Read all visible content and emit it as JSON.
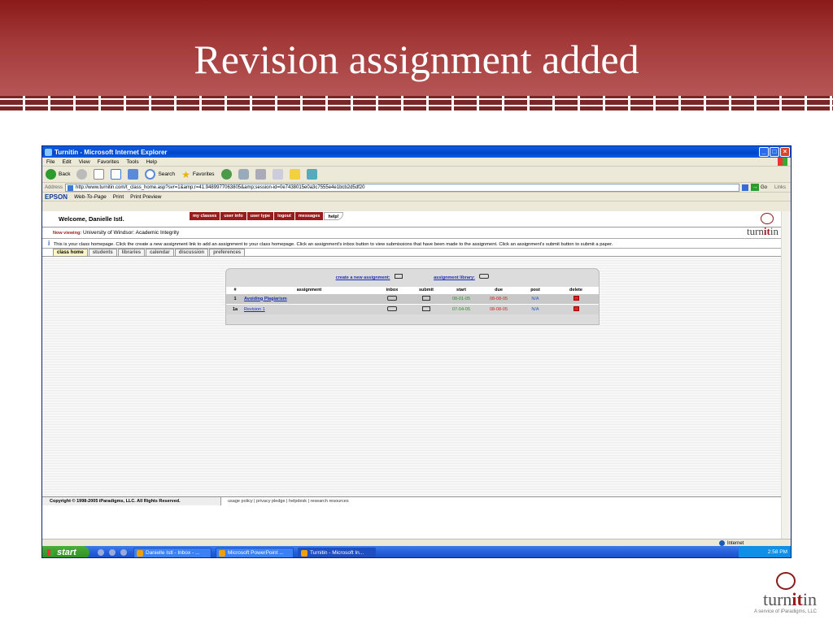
{
  "slide": {
    "title": "Revision assignment added"
  },
  "window": {
    "title": "Turnitin - Microsoft Internet Explorer",
    "menu": [
      "File",
      "Edit",
      "View",
      "Favorites",
      "Tools",
      "Help"
    ],
    "toolbar": {
      "back": "Back",
      "search": "Search",
      "favorites": "Favorites"
    },
    "address": {
      "label": "Address",
      "url": "http://www.turnitin.com/t_class_home.asp?svr=1&amp;r=41.9489977063805&amp;session-id=0e7438015e0a3c7555e4e1bcb2d5df20",
      "go": "Go",
      "links": "Links"
    },
    "epson": {
      "brand": "EPSON",
      "webtopage": "Web-To-Page",
      "print": "Print",
      "preview": "Print Preview"
    }
  },
  "turnitin": {
    "welcome": "Welcome, Danielle Istl.",
    "nav": [
      "my classes",
      "user info",
      "user type",
      "logout",
      "messages",
      "help!"
    ],
    "logo_pre": "turn",
    "logo_mid": "it",
    "logo_post": "in",
    "viewing_label": "Now viewing:",
    "viewing_value": "University of Windsor: Academic Integrity",
    "info": "This is your class homepage. Click the create a new assignment link to add an assignment to your class homepage. Click an assignment's inbox button to view submissions that have been made to the assignment. Click an assignment's submit button to submit a paper.",
    "tabs": [
      "class home",
      "students",
      "libraries",
      "calendar",
      "discussion",
      "preferences"
    ],
    "create_link": "create a new assignment:",
    "library_link": "assignment library:",
    "columns": [
      "#",
      "assignment",
      "inbox",
      "submit",
      "start",
      "due",
      "post",
      "delete"
    ],
    "rows": [
      {
        "num": "1",
        "name": "Avoiding Plagiarism",
        "start": "08-01-05",
        "due": "08-08-05",
        "post": "N/A"
      },
      {
        "num": "1a",
        "name": "Revision 1",
        "start": "07-04-05",
        "due": "08-08-05",
        "post": "N/A"
      }
    ],
    "copyright": "Copyright © 1998-2005 iParadigms, LLC. All Rights Reserved.",
    "footer_links": "usage policy | privacy pledge | helpdesk | research resources"
  },
  "status": {
    "zone": "Internet"
  },
  "taskbar": {
    "start": "start",
    "items": [
      "Danielle Istl - Inbox - ...",
      "Microsoft PowerPoint ...",
      "Turnitin - Microsoft In..."
    ],
    "clock": "2:58 PM"
  },
  "brand": {
    "pre": "turn",
    "mid": "it",
    "post": "in",
    "sub": "A service of iParadigms, LLC"
  }
}
